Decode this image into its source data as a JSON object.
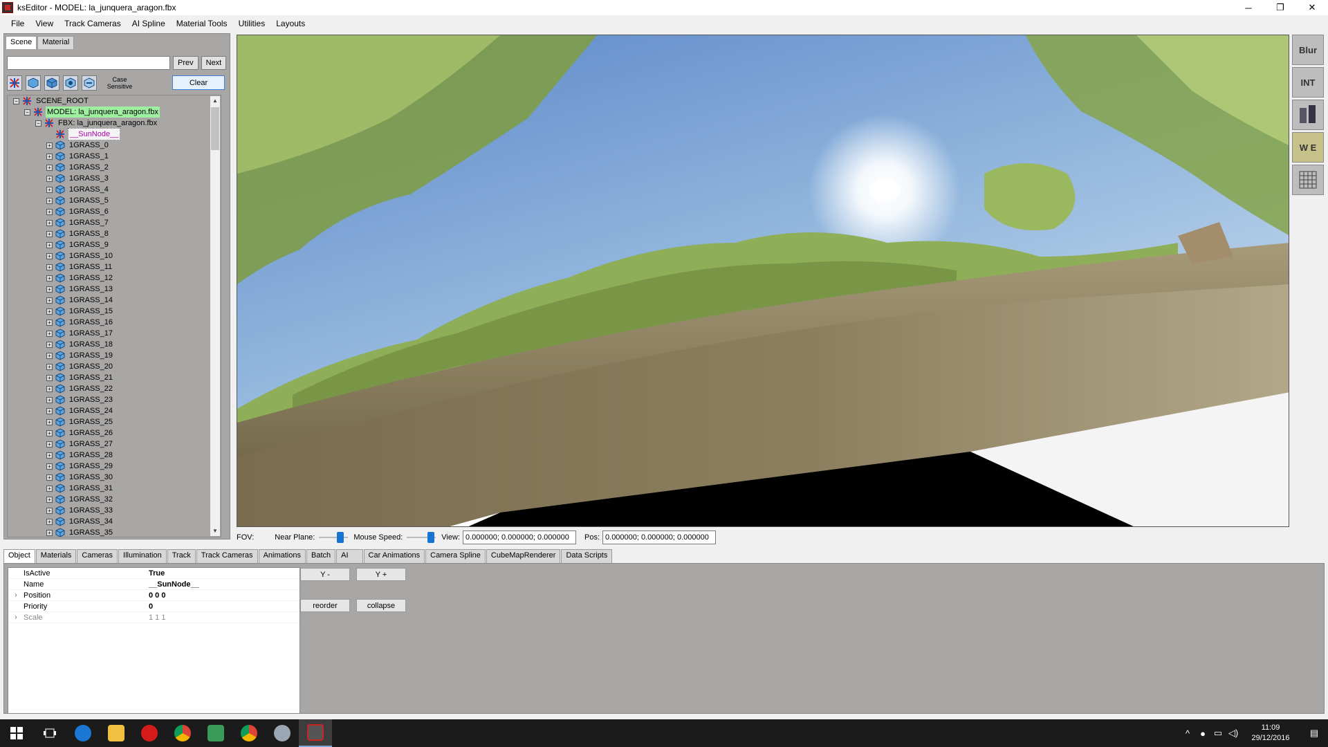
{
  "window": {
    "title": "ksEditor - MODEL: la_junquera_aragon.fbx",
    "minimize": "─",
    "restore": "❐",
    "close": "✕"
  },
  "menu": [
    "File",
    "View",
    "Track Cameras",
    "AI Spline",
    "Material Tools",
    "Utilities",
    "Layouts"
  ],
  "left_panel": {
    "tabs": [
      "Scene",
      "Material"
    ],
    "search": {
      "value": "",
      "placeholder": ""
    },
    "prev_label": "Prev",
    "next_label": "Next",
    "case_sensitive_label_1": "Case",
    "case_sensitive_label_2": "Sensitive",
    "clear_label": "Clear",
    "tree": [
      {
        "label": "SCENE_ROOT",
        "level": 0,
        "expander": "−",
        "style": ""
      },
      {
        "label": "MODEL: la_junquera_aragon.fbx",
        "level": 1,
        "expander": "−",
        "style": "green"
      },
      {
        "label": "FBX: la_junquera_aragon.fbx",
        "level": 2,
        "expander": "−",
        "style": ""
      },
      {
        "label": "__SunNode__",
        "level": 3,
        "expander": "",
        "style": "sun"
      },
      {
        "label": "1GRASS_0",
        "level": 3,
        "expander": "+",
        "style": ""
      },
      {
        "label": "1GRASS_1",
        "level": 3,
        "expander": "+",
        "style": ""
      },
      {
        "label": "1GRASS_2",
        "level": 3,
        "expander": "+",
        "style": ""
      },
      {
        "label": "1GRASS_3",
        "level": 3,
        "expander": "+",
        "style": ""
      },
      {
        "label": "1GRASS_4",
        "level": 3,
        "expander": "+",
        "style": ""
      },
      {
        "label": "1GRASS_5",
        "level": 3,
        "expander": "+",
        "style": ""
      },
      {
        "label": "1GRASS_6",
        "level": 3,
        "expander": "+",
        "style": ""
      },
      {
        "label": "1GRASS_7",
        "level": 3,
        "expander": "+",
        "style": ""
      },
      {
        "label": "1GRASS_8",
        "level": 3,
        "expander": "+",
        "style": ""
      },
      {
        "label": "1GRASS_9",
        "level": 3,
        "expander": "+",
        "style": ""
      },
      {
        "label": "1GRASS_10",
        "level": 3,
        "expander": "+",
        "style": ""
      },
      {
        "label": "1GRASS_11",
        "level": 3,
        "expander": "+",
        "style": ""
      },
      {
        "label": "1GRASS_12",
        "level": 3,
        "expander": "+",
        "style": ""
      },
      {
        "label": "1GRASS_13",
        "level": 3,
        "expander": "+",
        "style": ""
      },
      {
        "label": "1GRASS_14",
        "level": 3,
        "expander": "+",
        "style": ""
      },
      {
        "label": "1GRASS_15",
        "level": 3,
        "expander": "+",
        "style": ""
      },
      {
        "label": "1GRASS_16",
        "level": 3,
        "expander": "+",
        "style": ""
      },
      {
        "label": "1GRASS_17",
        "level": 3,
        "expander": "+",
        "style": ""
      },
      {
        "label": "1GRASS_18",
        "level": 3,
        "expander": "+",
        "style": ""
      },
      {
        "label": "1GRASS_19",
        "level": 3,
        "expander": "+",
        "style": ""
      },
      {
        "label": "1GRASS_20",
        "level": 3,
        "expander": "+",
        "style": ""
      },
      {
        "label": "1GRASS_21",
        "level": 3,
        "expander": "+",
        "style": ""
      },
      {
        "label": "1GRASS_22",
        "level": 3,
        "expander": "+",
        "style": ""
      },
      {
        "label": "1GRASS_23",
        "level": 3,
        "expander": "+",
        "style": ""
      },
      {
        "label": "1GRASS_24",
        "level": 3,
        "expander": "+",
        "style": ""
      },
      {
        "label": "1GRASS_25",
        "level": 3,
        "expander": "+",
        "style": ""
      },
      {
        "label": "1GRASS_26",
        "level": 3,
        "expander": "+",
        "style": ""
      },
      {
        "label": "1GRASS_27",
        "level": 3,
        "expander": "+",
        "style": ""
      },
      {
        "label": "1GRASS_28",
        "level": 3,
        "expander": "+",
        "style": ""
      },
      {
        "label": "1GRASS_29",
        "level": 3,
        "expander": "+",
        "style": ""
      },
      {
        "label": "1GRASS_30",
        "level": 3,
        "expander": "+",
        "style": ""
      },
      {
        "label": "1GRASS_31",
        "level": 3,
        "expander": "+",
        "style": ""
      },
      {
        "label": "1GRASS_32",
        "level": 3,
        "expander": "+",
        "style": ""
      },
      {
        "label": "1GRASS_33",
        "level": 3,
        "expander": "+",
        "style": ""
      },
      {
        "label": "1GRASS_34",
        "level": 3,
        "expander": "+",
        "style": ""
      },
      {
        "label": "1GRASS_35",
        "level": 3,
        "expander": "+",
        "style": ""
      }
    ]
  },
  "right_toolbar": [
    "Blur",
    "INT",
    "",
    "W E",
    ""
  ],
  "status_row": {
    "fov_label": "FOV:",
    "near_plane_label": "Near Plane:",
    "mouse_speed_label": "Mouse Speed:",
    "view_label": "View:",
    "view_value": "0.000000; 0.000000; 0.000000",
    "pos_label": "Pos:",
    "pos_value": "0.000000; 0.000000; 0.000000"
  },
  "bottom_tabs": [
    "Object",
    "Materials",
    "Cameras",
    "Illumination",
    "Track",
    "Track Cameras",
    "Animations",
    "Batch",
    "AI",
    "Car Animations",
    "Camera Spline",
    "CubeMapRenderer",
    "Data Scripts"
  ],
  "properties": [
    {
      "name": "IsActive",
      "value": "True",
      "expandable": false,
      "dim": false
    },
    {
      "name": "Name",
      "value": "__SunNode__",
      "expandable": false,
      "dim": false
    },
    {
      "name": "Position",
      "value": "0 0 0",
      "expandable": true,
      "dim": false
    },
    {
      "name": "Priority",
      "value": "0",
      "expandable": false,
      "dim": false
    },
    {
      "name": "Scale",
      "value": "1 1 1",
      "expandable": true,
      "dim": true
    }
  ],
  "actions": {
    "y_minus": "Y -",
    "y_plus": "Y +",
    "reorder": "reorder",
    "collapse": "collapse"
  },
  "taskbar": {
    "time": "11:09",
    "date": "29/12/2016",
    "apps": [
      "start",
      "task-view",
      "edge",
      "file-explorer",
      "opera",
      "chrome",
      "3ds",
      "chrome-2",
      "tool",
      "kseditor"
    ]
  }
}
